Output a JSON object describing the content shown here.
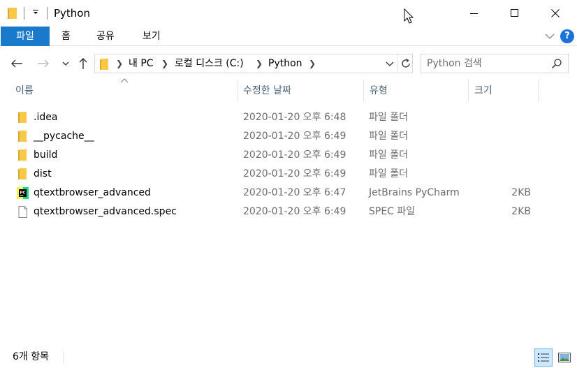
{
  "window": {
    "title": "Python",
    "minimize_icon": "minimize-icon",
    "maximize_icon": "maximize-icon",
    "close_icon": "close-icon"
  },
  "ribbon": {
    "file_tab": "파일",
    "tabs": [
      "홈",
      "공유",
      "보기"
    ]
  },
  "address": {
    "crumbs": [
      "내 PC",
      "로컬 디스크 (C:)",
      "Python"
    ]
  },
  "search": {
    "placeholder": "Python 검색"
  },
  "columns": {
    "name": "이름",
    "date": "수정한 날짜",
    "type": "유형",
    "size": "크기"
  },
  "files": [
    {
      "icon": "folder-icon",
      "name": ".idea",
      "date": "2020-01-20 오후 6:48",
      "type": "파일 폴더",
      "size": ""
    },
    {
      "icon": "folder-icon",
      "name": "__pycache__",
      "date": "2020-01-20 오후 6:49",
      "type": "파일 폴더",
      "size": ""
    },
    {
      "icon": "folder-icon",
      "name": "build",
      "date": "2020-01-20 오후 6:49",
      "type": "파일 폴더",
      "size": ""
    },
    {
      "icon": "folder-icon",
      "name": "dist",
      "date": "2020-01-20 오후 6:49",
      "type": "파일 폴더",
      "size": ""
    },
    {
      "icon": "pycharm-icon",
      "name": "qtextbrowser_advanced",
      "date": "2020-01-20 오후 6:47",
      "type": "JetBrains PyCharm",
      "size": "2KB"
    },
    {
      "icon": "file-icon",
      "name": "qtextbrowser_advanced.spec",
      "date": "2020-01-20 오후 6:49",
      "type": "SPEC 파일",
      "size": "2KB"
    }
  ],
  "status": {
    "item_count": "6개 항목"
  },
  "colors": {
    "accent": "#1979ca",
    "folder": "#f8c948",
    "header_text": "#4c607a",
    "secondary_text": "#6d6d6d"
  }
}
